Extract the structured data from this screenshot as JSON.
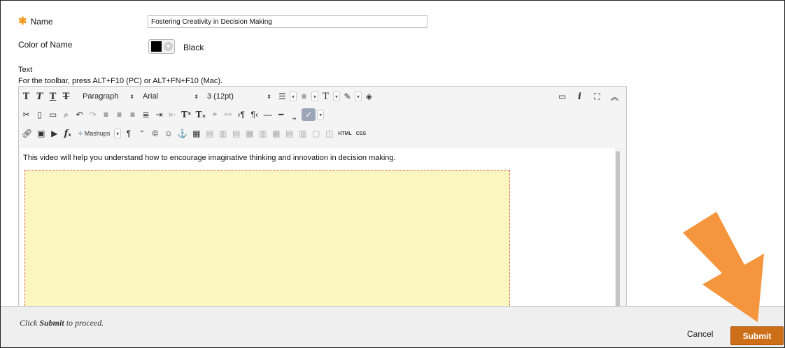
{
  "form": {
    "name_label": "Name",
    "required_marker": "✱",
    "name_value": "Fostering Creativity in Decision Making",
    "color_label": "Color of Name",
    "color_value_name": "Black",
    "color_value_hex": "#000000",
    "text_label": "Text",
    "toolbar_hint": "For the toolbar, press ALT+F10 (PC) or ALT+FN+F10 (Mac)."
  },
  "editor": {
    "format_select": "Paragraph",
    "font_select": "Arial",
    "size_select": "3 (12pt)",
    "mashups_label": "Mashups",
    "html_label": "HTML",
    "css_label": "CSS",
    "content_text": "This video will help you understand how to encourage imaginative thinking and innovation in decision making.",
    "placeholder_color": "#fbf6c0"
  },
  "footer": {
    "hint_prefix": "Click",
    "hint_bold": "Submit",
    "hint_suffix": "to proceed.",
    "cancel_label": "Cancel",
    "submit_label": "Submit",
    "submit_color": "#cd6f19"
  },
  "annotation": {
    "arrow_color": "#f5953e",
    "points_to": "submit-button"
  }
}
